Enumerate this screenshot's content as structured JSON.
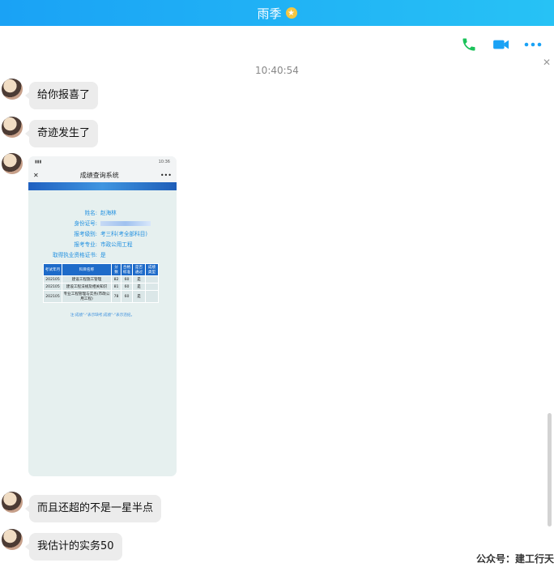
{
  "window": {
    "title": "雨季",
    "star_icon": "★"
  },
  "toolbar": {
    "call_icon": "phone-icon",
    "video_icon": "video-camera-icon",
    "more_icon": "more-icon",
    "close_icon": "✕",
    "colors": {
      "call": "#1bc25a",
      "video": "#1aa2f5",
      "more": "#1aa2f5"
    }
  },
  "chat": {
    "timestamp": "10:40:54",
    "messages": [
      {
        "text": "给你报喜了"
      },
      {
        "text": "奇迹发生了"
      },
      {
        "type": "image"
      },
      {
        "text": "而且还超的不是一星半点"
      },
      {
        "text": "我估计的实务50"
      }
    ]
  },
  "screenshot": {
    "status_time": "10:36",
    "header_title": "成绩查询系统",
    "close_glyph": "✕",
    "more_glyph": "•••",
    "info": [
      {
        "label": "姓名:",
        "value": "赵海林"
      },
      {
        "label": "身份证号:",
        "value": ""
      },
      {
        "label": "报考级别:",
        "value": "考三科(考全部科目)"
      },
      {
        "label": "报考专业:",
        "value": "市政公用工程"
      },
      {
        "label": "取得执业资格证书:",
        "value": "是"
      }
    ],
    "table": {
      "headers": [
        "考试年月",
        "科目名称",
        "分数",
        "合格标准",
        "是否通过",
        "成绩类型"
      ],
      "rows": [
        [
          "202105",
          "建设工程施工管理",
          "82",
          "60",
          "是",
          ""
        ],
        [
          "202105",
          "建设工程法规及相关知识",
          "81",
          "60",
          "是",
          ""
        ],
        [
          "202105",
          "专业工程管理与实务(市政公用工程)",
          "78",
          "60",
          "是",
          ""
        ]
      ]
    },
    "footnote": "注:成绩\"-\"表示缺考;成绩\"-\"表示违纪。"
  },
  "watermark": "公众号：建工行天"
}
